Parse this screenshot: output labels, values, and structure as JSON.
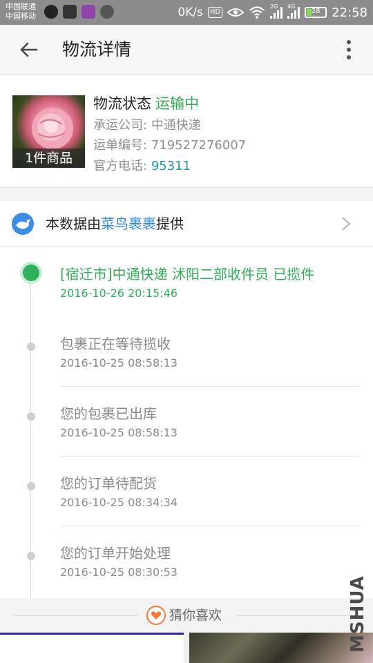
{
  "status_bar": {
    "carrier_1": "中国联通",
    "carrier_2": "中国移动",
    "speed": "0K/s",
    "hd": "HD",
    "net_1": "2G",
    "net_2": "4G",
    "battery_level": 28,
    "battery_text": "28",
    "time": "22:58"
  },
  "header": {
    "title": "物流详情",
    "back_icon": "arrow-left-icon",
    "more_icon": "more-vertical-icon"
  },
  "package": {
    "image_caption": "1件商品",
    "status_label": "物流状态",
    "status_value": "运输中",
    "carrier_label": "承运公司:",
    "carrier_value": "中通快递",
    "waybill_label": "运单编号:",
    "waybill_value": "719527276007",
    "phone_label": "官方电话:",
    "phone_value": "95311"
  },
  "source": {
    "prefix": "本数据由",
    "brand": "菜鸟裹裹",
    "suffix": "提供"
  },
  "timeline": [
    {
      "text": "[宿迁市]中通快递 沭阳二部收件员 已揽件",
      "time": "2016-10-26 20:15:46",
      "current": true
    },
    {
      "text": "包裹正在等待揽收",
      "time": "2016-10-25 08:58:13",
      "current": false
    },
    {
      "text": "您的包裹已出库",
      "time": "2016-10-25 08:58:13",
      "current": false
    },
    {
      "text": "您的订单待配货",
      "time": "2016-10-25 08:34:34",
      "current": false
    },
    {
      "text": "您的订单开始处理",
      "time": "2016-10-25 08:30:53",
      "current": false
    }
  ],
  "recommend": {
    "label": "猜你喜欢",
    "icon": "heart-icon"
  },
  "watermark": "MSHUA",
  "colors": {
    "accent_green": "#2fae56",
    "link_blue": "#2f8be0",
    "phone_teal": "#1a9aa8"
  }
}
